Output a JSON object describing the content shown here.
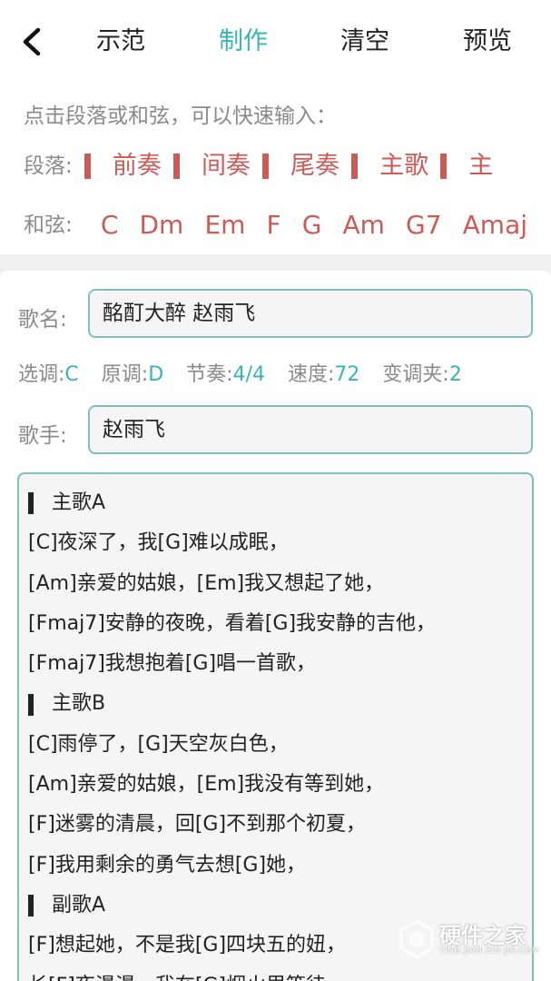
{
  "header": {
    "tabs": [
      {
        "label": "示范",
        "active": false
      },
      {
        "label": "制作",
        "active": true
      },
      {
        "label": "清空",
        "active": false
      },
      {
        "label": "预览",
        "active": false
      }
    ]
  },
  "quick_input": {
    "hint": "点击段落或和弦，可以快速输入：",
    "segments_label": "段落:",
    "segments": [
      "前奏",
      "间奏",
      "尾奏",
      "主歌",
      "主"
    ],
    "chords_label": "和弦:",
    "chords": [
      "C",
      "Dm",
      "Em",
      "F",
      "G",
      "Am",
      "G7",
      "Amaj"
    ]
  },
  "form": {
    "song_name_label": "歌名:",
    "song_name_value": "酩酊大醉 赵雨飞",
    "meta": {
      "key_label": "选调:",
      "key_value": "C",
      "original_label": "原调:",
      "original_value": "D",
      "beat_label": "节奏:",
      "beat_value": "4/4",
      "tempo_label": "速度:",
      "tempo_value": "72",
      "capo_label": "变调夹:",
      "capo_value": "2"
    },
    "singer_label": "歌手:",
    "singer_value": "赵雨飞"
  },
  "lyrics": [
    {
      "type": "section",
      "text": "主歌A"
    },
    {
      "type": "line",
      "text": "[C]夜深了，我[G]难以成眠，"
    },
    {
      "type": "line",
      "text": "[Am]亲爱的姑娘，[Em]我又想起了她，"
    },
    {
      "type": "line",
      "text": "[Fmaj7]安静的夜晚，看着[G]我安静的吉他，"
    },
    {
      "type": "line",
      "text": "[Fmaj7]我想抱着[G]唱一首歌，"
    },
    {
      "type": "section",
      "text": "主歌B"
    },
    {
      "type": "line",
      "text": "[C]雨停了，[G]天空灰白色，"
    },
    {
      "type": "line",
      "text": "[Am]亲爱的姑娘，[Em]我没有等到她，"
    },
    {
      "type": "line",
      "text": "[F]迷雾的清晨，回[G]不到那个初夏，"
    },
    {
      "type": "line",
      "text": "[F]我用剩余的勇气去想[G]她，"
    },
    {
      "type": "section",
      "text": "副歌A"
    },
    {
      "type": "line",
      "text": "[F]想起她，不是我[G]四块五的妞，"
    },
    {
      "type": "line",
      "text": "长[F]夜漫漫，我在[G]烟火里等待，"
    }
  ],
  "watermark": {
    "title": "硬件之家",
    "subtitle": "YING JIAN ZHI JIA.COM"
  },
  "colors": {
    "accent": "#3ab3b3",
    "segment_red": "#cc5a57",
    "field_border": "#7fbfbf"
  }
}
